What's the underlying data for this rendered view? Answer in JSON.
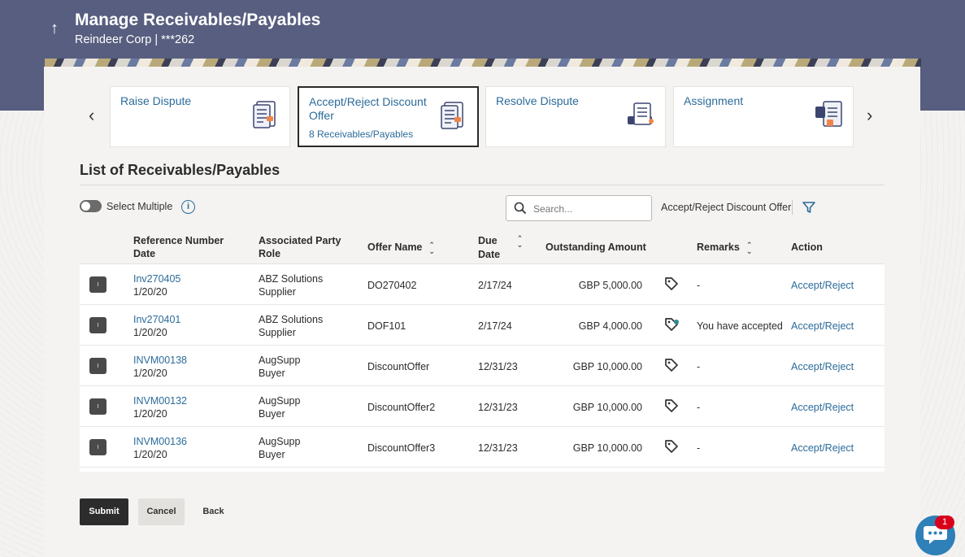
{
  "header": {
    "title": "Manage Receivables/Payables",
    "subtitle": "Reindeer Corp | ***262"
  },
  "tiles": [
    {
      "title": "Raise Dispute",
      "count": "",
      "icon": "document-list-icon"
    },
    {
      "title": "Accept/Reject Discount Offer",
      "count": "8 Receivables/Payables",
      "icon": "document-list-icon",
      "active": true
    },
    {
      "title": "Resolve Dispute",
      "count": "",
      "icon": "document-stack-icon"
    },
    {
      "title": "Assignment",
      "count": "",
      "icon": "document-assign-icon"
    }
  ],
  "list": {
    "title": "List of Receivables/Payables",
    "select_multiple_label": "Select Multiple",
    "search_placeholder": "Search...",
    "filter_label": "Accept/Reject Discount Offer",
    "columns": {
      "ref_line1": "Reference Number",
      "ref_line2": "Date",
      "party_line1": "Associated Party",
      "party_line2": "Role",
      "offer_name": "Offer Name",
      "due_line1": "Due",
      "due_line2": "Date",
      "outstanding": "Outstanding Amount",
      "remarks": "Remarks",
      "action": "Action"
    },
    "rows": [
      {
        "ref": "Inv270405",
        "date": "1/20/20",
        "party": "ABZ Solutions",
        "role": "Supplier",
        "offer": "DO270402",
        "due": "2/17/24",
        "amount": "GBP 5,000.00",
        "remarks": "-",
        "action": "Accept/Reject"
      },
      {
        "ref": "Inv270401",
        "date": "1/20/20",
        "party": "ABZ Solutions",
        "role": "Supplier",
        "offer": "DOF101",
        "due": "2/17/24",
        "amount": "GBP 4,000.00",
        "remarks": "You have accepted",
        "action": "Accept/Reject"
      },
      {
        "ref": "INVM00138",
        "date": "1/20/20",
        "party": "AugSupp",
        "role": "Buyer",
        "offer": "DiscountOffer",
        "due": "12/31/23",
        "amount": "GBP 10,000.00",
        "remarks": "-",
        "action": "Accept/Reject"
      },
      {
        "ref": "INVM00132",
        "date": "1/20/20",
        "party": "AugSupp",
        "role": "Buyer",
        "offer": "DiscountOffer2",
        "due": "12/31/23",
        "amount": "GBP 10,000.00",
        "remarks": "-",
        "action": "Accept/Reject"
      },
      {
        "ref": "INVM00136",
        "date": "1/20/20",
        "party": "AugSupp",
        "role": "Buyer",
        "offer": "DiscountOffer3",
        "due": "12/31/23",
        "amount": "GBP 10,000.00",
        "remarks": "-",
        "action": "Accept/Reject"
      }
    ]
  },
  "buttons": {
    "submit": "Submit",
    "cancel": "Cancel",
    "back": "Back"
  },
  "chat": {
    "badge_count": "1"
  },
  "colors": {
    "header_bg": "#575e7f",
    "link": "#2b6b9a",
    "primary_button": "#2c2c2c",
    "chat_button": "#2f7fb8",
    "badge": "#d9001b"
  }
}
